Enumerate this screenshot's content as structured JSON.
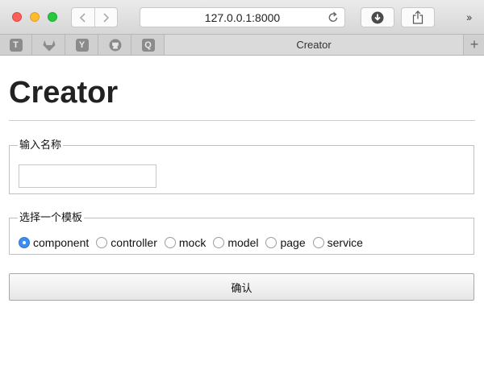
{
  "browser": {
    "url": "127.0.0.1:8000",
    "more_chevron": "››",
    "pinned_tabs": [
      {
        "letter": "T",
        "icon": "t-favicon"
      },
      {
        "letter": "",
        "icon": "gitlab-icon"
      },
      {
        "letter": "Y",
        "icon": "y-favicon"
      },
      {
        "letter": "",
        "icon": "github-icon"
      },
      {
        "letter": "Q",
        "icon": "q-favicon"
      }
    ],
    "active_tab_title": "Creator",
    "new_tab_symbol": "+"
  },
  "page": {
    "title": "Creator",
    "name_section": {
      "legend": "输入名称",
      "input_value": "",
      "input_placeholder": ""
    },
    "template_section": {
      "legend": "选择一个模板",
      "options": [
        "component",
        "controller",
        "mock",
        "model",
        "page",
        "service"
      ],
      "selected": "component"
    },
    "confirm_label": "确认"
  },
  "colors": {
    "radio_checked": "#3b8df1",
    "close": "#fc5f57",
    "minimize": "#fdbc2e",
    "zoom": "#28c840"
  }
}
